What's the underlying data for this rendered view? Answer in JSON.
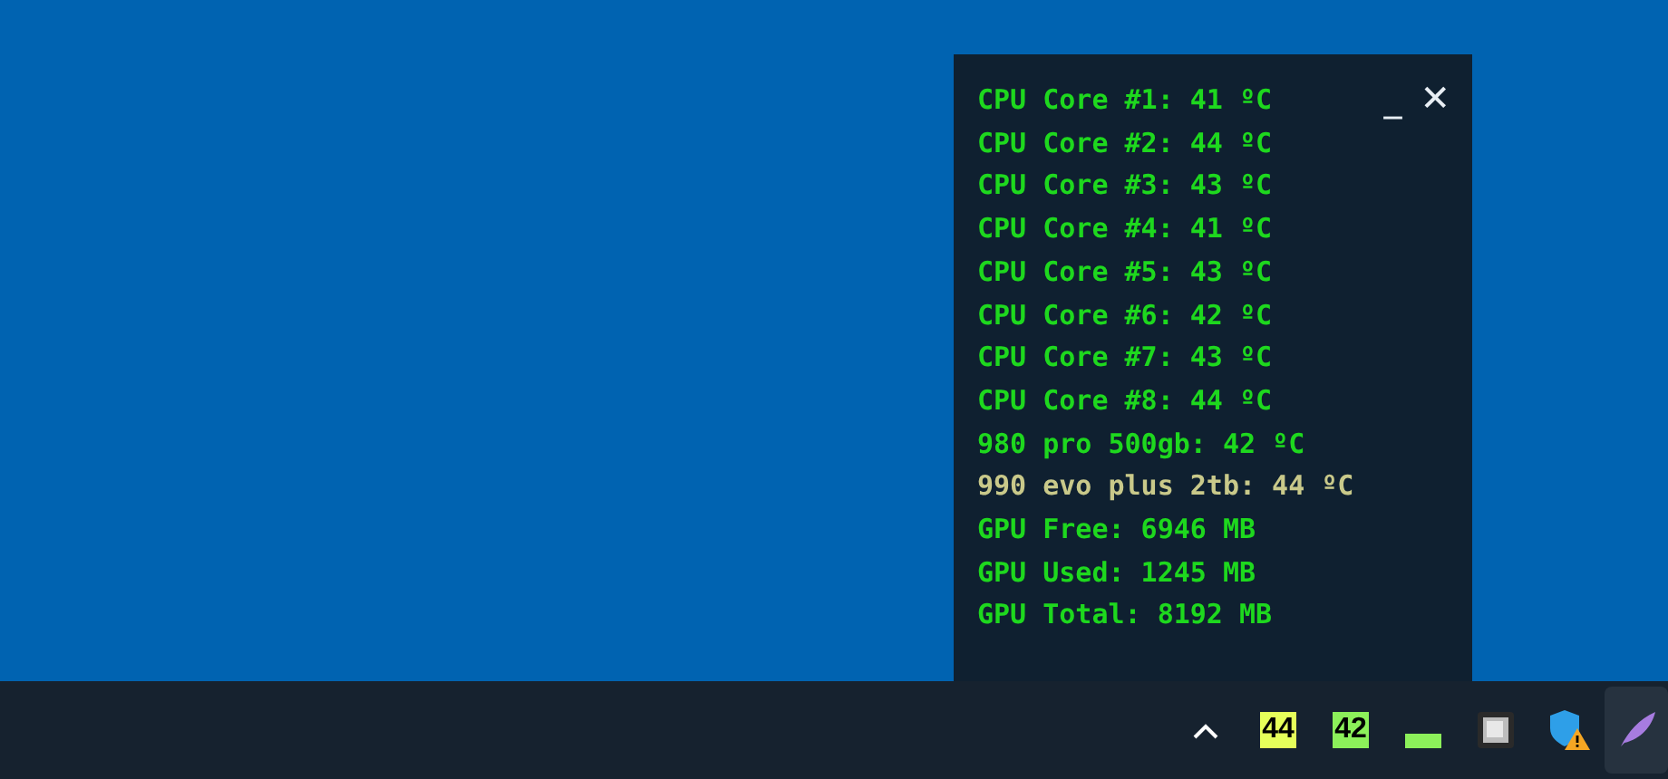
{
  "monitor": {
    "minimize": "_",
    "close": "✕",
    "lines": [
      {
        "text": "CPU Core #1: 41 ºC",
        "color": "#1ed81e"
      },
      {
        "text": "CPU Core #2: 44 ºC",
        "color": "#1ed81e"
      },
      {
        "text": "CPU Core #3: 43 ºC",
        "color": "#1ed81e"
      },
      {
        "text": "CPU Core #4: 41 ºC",
        "color": "#1ed81e"
      },
      {
        "text": "CPU Core #5: 43 ºC",
        "color": "#1ed81e"
      },
      {
        "text": "CPU Core #6: 42 ºC",
        "color": "#1ed81e"
      },
      {
        "text": "CPU Core #7: 43 ºC",
        "color": "#1ed81e"
      },
      {
        "text": "CPU Core #8: 44 ºC",
        "color": "#1ed81e"
      },
      {
        "text": "980 pro 500gb: 42 ºC",
        "color": "#1ed81e"
      },
      {
        "text": "990 evo plus 2tb: 44 ºC",
        "color": "#c9c98a"
      },
      {
        "text": "GPU Free: 6946 MB",
        "color": "#1ed81e"
      },
      {
        "text": "GPU Used: 1245 MB",
        "color": "#1ed81e"
      },
      {
        "text": "GPU Total: 8192 MB",
        "color": "#1ed81e"
      }
    ]
  },
  "taskbar": {
    "tray": [
      {
        "kind": "chevron"
      },
      {
        "kind": "badge",
        "text": "44",
        "color": "#e6ff5a"
      },
      {
        "kind": "badge",
        "text": "42",
        "color": "#8cf05a"
      },
      {
        "kind": "bar",
        "color": "#8cf05a"
      },
      {
        "kind": "chip"
      },
      {
        "kind": "shield"
      },
      {
        "kind": "feather",
        "selected": true
      }
    ]
  }
}
